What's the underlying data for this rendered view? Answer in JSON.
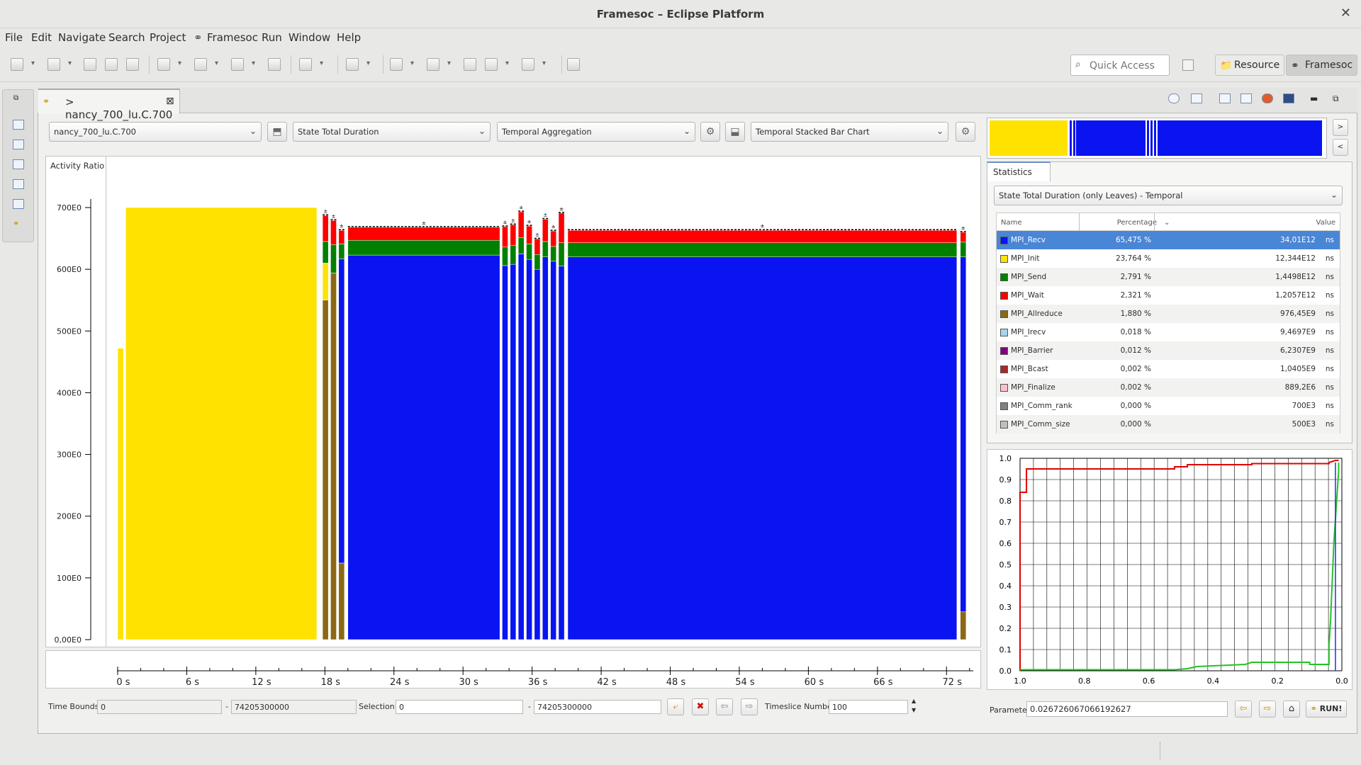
{
  "window": {
    "title": "Framesoc – Eclipse Platform",
    "close": "✕"
  },
  "menu": [
    "File",
    "Edit",
    "Navigate",
    "Search",
    "Project",
    "Framesoc",
    "Run",
    "Window",
    "Help"
  ],
  "quick_access": {
    "placeholder": "Quick Access"
  },
  "perspectives": [
    {
      "label": "Resource",
      "icon": "resource-perspective-icon",
      "active": false
    },
    {
      "label": "Framesoc",
      "icon": "framesoc-perspective-icon",
      "active": true
    }
  ],
  "editor_tab": {
    "label": "> nancy_700_lu.C.700",
    "close": "⊠"
  },
  "controls": {
    "trace": "nancy_700_lu.C.700",
    "metric": "State Total Duration",
    "operator": "Temporal Aggregation",
    "chart": "Temporal Stacked Bar Chart"
  },
  "main_chart": {
    "y_label": "Activity Ratio",
    "y_ticks": [
      "0,00E0",
      "100E0",
      "200E0",
      "300E0",
      "400E0",
      "500E0",
      "600E0",
      "700E0"
    ],
    "x_ticks": [
      "0 s",
      "6 s",
      "12 s",
      "18 s",
      "24 s",
      "30 s",
      "36 s",
      "42 s",
      "48 s",
      "54 s",
      "60 s",
      "66 s",
      "72 s"
    ]
  },
  "chart_data": {
    "type": "bar",
    "title": "",
    "xlabel": "",
    "ylabel": "Activity Ratio",
    "ylim": [
      0,
      700
    ],
    "xlim": [
      0,
      74.2
    ],
    "stacked": true,
    "colors": {
      "MPI_Recv": "#0a14f0",
      "MPI_Init": "#ffe200",
      "MPI_Send": "#008000",
      "MPI_Wait": "#ff0000",
      "MPI_Allreduce": "#8b6914"
    },
    "bars": [
      {
        "x0": 0.0,
        "x1": 0.5,
        "values": {
          "MPI_Init": 472
        }
      },
      {
        "x0": 0.7,
        "x1": 17.3,
        "values": {
          "MPI_Init": 700
        }
      },
      {
        "x0": 17.8,
        "x1": 18.3,
        "values": {
          "MPI_Allreduce": 550,
          "MPI_Init": 60,
          "MPI_Send": 35,
          "MPI_Wait": 42
        }
      },
      {
        "x0": 18.5,
        "x1": 19.0,
        "values": {
          "MPI_Allreduce": 594,
          "MPI_Init": 0,
          "MPI_Send": 46,
          "MPI_Wait": 39
        }
      },
      {
        "x0": 19.2,
        "x1": 19.7,
        "values": {
          "MPI_Allreduce": 124,
          "MPI_Recv": 493,
          "MPI_Send": 24,
          "MPI_Wait": 22
        }
      },
      {
        "x0": 20.0,
        "x1": 33.2,
        "values": {
          "MPI_Recv": 623,
          "MPI_Send": 24,
          "MPI_Wait": 21
        }
      },
      {
        "x0": 33.4,
        "x1": 33.9,
        "values": {
          "MPI_Recv": 606,
          "MPI_Send": 30,
          "MPI_Wait": 33
        }
      },
      {
        "x0": 34.1,
        "x1": 34.6,
        "values": {
          "MPI_Recv": 608,
          "MPI_Send": 31,
          "MPI_Wait": 33
        }
      },
      {
        "x0": 34.8,
        "x1": 35.3,
        "values": {
          "MPI_Recv": 625,
          "MPI_Send": 26,
          "MPI_Wait": 42
        }
      },
      {
        "x0": 35.5,
        "x1": 36.0,
        "values": {
          "MPI_Recv": 616,
          "MPI_Send": 25,
          "MPI_Wait": 29
        }
      },
      {
        "x0": 36.2,
        "x1": 36.7,
        "values": {
          "MPI_Recv": 600,
          "MPI_Send": 24,
          "MPI_Wait": 25
        }
      },
      {
        "x0": 36.9,
        "x1": 37.4,
        "values": {
          "MPI_Recv": 620,
          "MPI_Send": 25,
          "MPI_Wait": 36
        }
      },
      {
        "x0": 37.6,
        "x1": 38.1,
        "values": {
          "MPI_Recv": 613,
          "MPI_Send": 24,
          "MPI_Wait": 25
        }
      },
      {
        "x0": 38.3,
        "x1": 38.8,
        "values": {
          "MPI_Recv": 605,
          "MPI_Send": 38,
          "MPI_Wait": 48
        }
      },
      {
        "x0": 39.1,
        "x1": 72.9,
        "values": {
          "MPI_Recv": 620,
          "MPI_Send": 23,
          "MPI_Wait": 20
        }
      },
      {
        "x0": 73.2,
        "x1": 73.7,
        "values": {
          "MPI_Allreduce": 45,
          "MPI_Recv": 575,
          "MPI_Send": 24,
          "MPI_Wait": 16
        }
      }
    ]
  },
  "statistics": {
    "tab": "Statistics",
    "selector": "State Total Duration (only Leaves) - Temporal",
    "headers": {
      "name": "Name",
      "percentage": "Percentage",
      "value": "Value"
    },
    "rows": [
      {
        "name": "MPI_Recv",
        "color": "#0a14f0",
        "pct": "65,475 %",
        "value": "34,01E12",
        "unit": "ns"
      },
      {
        "name": "MPI_Init",
        "color": "#ffe200",
        "pct": "23,764 %",
        "value": "12,344E12",
        "unit": "ns"
      },
      {
        "name": "MPI_Send",
        "color": "#008000",
        "pct": "2,791 %",
        "value": "1,4498E12",
        "unit": "ns"
      },
      {
        "name": "MPI_Wait",
        "color": "#ff0000",
        "pct": "2,321 %",
        "value": "1,2057E12",
        "unit": "ns"
      },
      {
        "name": "MPI_Allreduce",
        "color": "#8b6914",
        "pct": "1,880 %",
        "value": "976,45E9",
        "unit": "ns"
      },
      {
        "name": "MPI_Irecv",
        "color": "#a6d4ec",
        "pct": "0,018 %",
        "value": "9,4697E9",
        "unit": "ns"
      },
      {
        "name": "MPI_Barrier",
        "color": "#800080",
        "pct": "0,012 %",
        "value": "6,2307E9",
        "unit": "ns"
      },
      {
        "name": "MPI_Bcast",
        "color": "#a52a2a",
        "pct": "0,002 %",
        "value": "1,0405E9",
        "unit": "ns"
      },
      {
        "name": "MPI_Finalize",
        "color": "#ffc0cb",
        "pct": "0,002 %",
        "value": "889,2E6",
        "unit": "ns"
      },
      {
        "name": "MPI_Comm_rank",
        "color": "#808080",
        "pct": "0,000 %",
        "value": "700E3",
        "unit": "ns"
      },
      {
        "name": "MPI_Comm_size",
        "color": "#c0c0c0",
        "pct": "0,000 %",
        "value": "500E3",
        "unit": "ns"
      }
    ]
  },
  "bottom": {
    "time_bounds_label": "Time Bounds:",
    "time_start": "0",
    "time_end": "74205300000",
    "selection_label": "Selection:",
    "sel_start": "0",
    "sel_end": "74205300000",
    "dash": "-",
    "timeslice_label": "Timeslice Number",
    "timeslice": "100"
  },
  "param": {
    "label": "Parameter",
    "value": "0.026726067066192627",
    "run": "RUN!"
  },
  "dt_chart": {
    "y_ticks": [
      "0.0",
      "0.1",
      "0.2",
      "0.3",
      "0.4",
      "0.5",
      "0.6",
      "0.7",
      "0.8",
      "0.9",
      "1.0"
    ],
    "x_ticks": [
      "1.0",
      "0.8",
      "0.6",
      "0.4",
      "0.2",
      "0.0"
    ]
  }
}
